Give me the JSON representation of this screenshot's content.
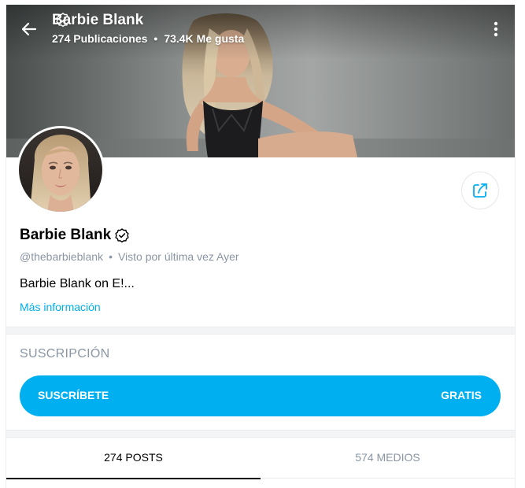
{
  "header": {
    "name": "Barbie Blank",
    "posts_count": "274",
    "posts_label": "Publicaciones",
    "separator": "•",
    "likes_count": "73.4K",
    "likes_label": "Me gusta"
  },
  "profile": {
    "name": "Barbie Blank",
    "handle": "@thebarbieblank",
    "separator": "•",
    "last_seen": "Visto por última vez Ayer",
    "bio": "Barbie Blank on E!...",
    "more_info": "Más información"
  },
  "subscription": {
    "title": "SUSCRIPCIÓN",
    "button_label": "SUSCRÍBETE",
    "price_label": "GRATIS"
  },
  "tabs": [
    {
      "label": "274 POSTS",
      "active": true
    },
    {
      "label": "574 MEDIOS",
      "active": false
    }
  ],
  "icons": {
    "back": "arrow-left-icon",
    "more": "vertical-dots-icon",
    "verified": "verified-badge-icon",
    "share": "share-icon"
  },
  "colors": {
    "accent": "#00aff0",
    "muted": "#8a96a3",
    "text": "#000000"
  }
}
